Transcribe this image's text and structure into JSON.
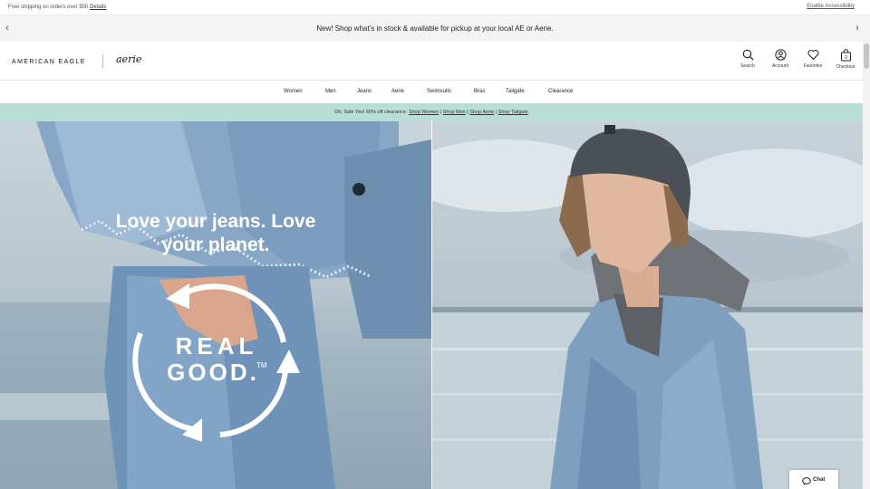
{
  "utility": {
    "shipping_text": "Free shipping on orders over $50",
    "shipping_link": "Details",
    "accessibility_link": "Enable Accessibility"
  },
  "promo": {
    "text": "New! Shop what’s in stock & available for pickup at your local AE or Aerie."
  },
  "brand": {
    "ae_logo": "AMERICAN EAGLE",
    "aerie_logo": "aerie"
  },
  "header_icons": [
    {
      "label": "Search",
      "icon": "search-icon"
    },
    {
      "label": "Account",
      "icon": "account-icon"
    },
    {
      "label": "Favorites",
      "icon": "heart-icon"
    },
    {
      "label": "Checkout",
      "icon": "bag-icon",
      "count": "0"
    }
  ],
  "nav": [
    "Women",
    "Men",
    "Jeans",
    "Aerie",
    "Swimsuits",
    "Bras",
    "Tailgate",
    "Clearance"
  ],
  "sale": {
    "text": "Oh, Sale Yes! 60% off clearance.",
    "links": [
      "Shop Women",
      "Shop Men",
      "Shop Aerie",
      "Shop Tailgate"
    ],
    "separator": "|"
  },
  "hero": {
    "left_logo_line1": "REAL",
    "left_logo_line2": "GOOD.",
    "left_logo_tm": "TM",
    "right_headline": "Love your jeans. Love your planet."
  },
  "chat": {
    "label": "Chat"
  },
  "colors": {
    "sale_bar": "#b9ddd7",
    "promo_bar": "#f4f4f4",
    "denim": "#7f9fbf"
  }
}
